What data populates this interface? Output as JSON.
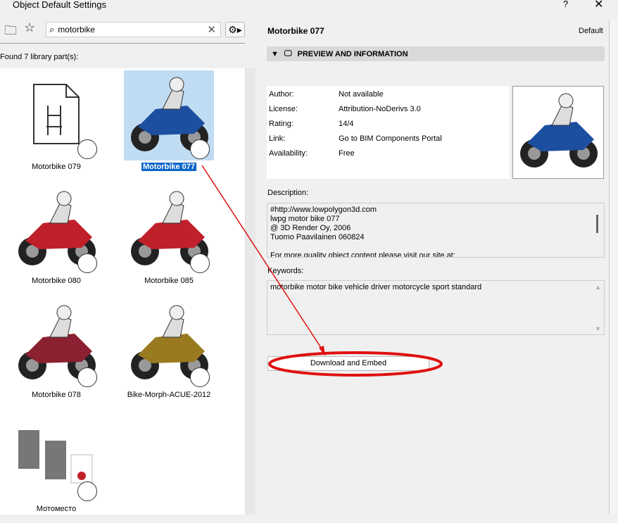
{
  "window": {
    "title": "Object Default Settings",
    "help": "?",
    "close": "✕"
  },
  "toolbar": {
    "search_value": "motorbike",
    "clear": "✕",
    "gear": "⚙▸"
  },
  "found_label": "Found 7 library part(s):",
  "items": [
    {
      "label": "Motorbike 079",
      "kind": "file",
      "selected": false
    },
    {
      "label": "Motorbike 077",
      "kind": "bike",
      "color": "#1c4fa0",
      "selected": true
    },
    {
      "label": "Motorbike 080",
      "kind": "bike",
      "color": "#c0202a",
      "selected": false
    },
    {
      "label": "Motorbike 085",
      "kind": "bike",
      "color": "#c0202a",
      "selected": false
    },
    {
      "label": "Motorbike 078",
      "kind": "bike",
      "color": "#8a2030",
      "selected": false
    },
    {
      "label": "Bike-Morph-ACUE-2012",
      "kind": "bike",
      "color": "#9a7a20",
      "selected": false
    },
    {
      "label": "Мотоместо",
      "kind": "boxes",
      "selected": false
    }
  ],
  "right": {
    "title": "Motorbike 077",
    "default": "Default",
    "section": "PREVIEW AND INFORMATION",
    "info": [
      {
        "k": "Author:",
        "v": "Not available"
      },
      {
        "k": "License:",
        "v": "Attribution-NoDerivs 3.0"
      },
      {
        "k": "Rating:",
        "v": "14/4"
      },
      {
        "k": "Link:",
        "v": "Go to BIM Components Portal"
      },
      {
        "k": "Availability:",
        "v": "Free"
      }
    ],
    "description_label": "Description:",
    "description": "#http://www.lowpolygon3d.com\nlwpg motor bike 077\n@ 3D Render Oy, 2006\nTuomo Paavilainen 060824\n\nFor more quality object content please visit our site at:",
    "keywords_label": "Keywords:",
    "keywords": "motorbike motor bike vehicle driver motorcycle sport standard",
    "download_label": "Download and Embed"
  },
  "annotation_color": "#e01010"
}
